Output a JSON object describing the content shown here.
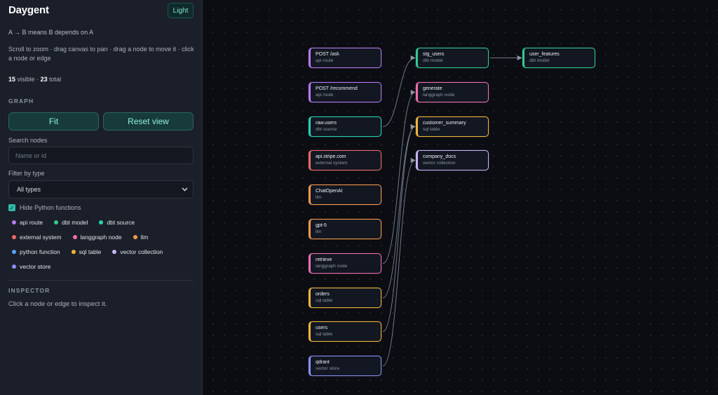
{
  "app": {
    "title": "Daygent",
    "theme_label": "Light"
  },
  "sidebar": {
    "legend_note": "A → B means B depends on A",
    "help": "Scroll to zoom · drag canvas to pan · drag a node to move it · click a node or edge",
    "visible_count": "15",
    "visible_label": "visible ·",
    "total_count": "23",
    "total_label": "total",
    "graph_header": "GRAPH",
    "fit_label": "Fit",
    "reset_label": "Reset view",
    "search_label": "Search nodes",
    "search_placeholder": "Name or id",
    "filter_label": "Filter by type",
    "filter_value": "All types",
    "hide_python_label": "Hide Python functions",
    "type_chips": [
      {
        "label": "api route",
        "color": "#b57af0"
      },
      {
        "label": "dbt model",
        "color": "#35c98f"
      },
      {
        "label": "dbt source",
        "color": "#2ad1b5"
      },
      {
        "label": "external system",
        "color": "#f06a6a"
      },
      {
        "label": "langgraph node",
        "color": "#ef6fae"
      },
      {
        "label": "llm",
        "color": "#f59a4a"
      },
      {
        "label": "python function",
        "color": "#5aa2f5"
      },
      {
        "label": "sql table",
        "color": "#f0b53a"
      },
      {
        "label": "vector collection",
        "color": "#c7b4f5"
      },
      {
        "label": "vector store",
        "color": "#8a8ff5"
      }
    ],
    "inspector_header": "INSPECTOR",
    "inspector_note": "Click a node or edge to inspect it."
  },
  "nodes": [
    {
      "id": "post-ask",
      "title": "POST /ask",
      "type": "api route",
      "color": "#b57af0"
    },
    {
      "id": "post-recommend",
      "title": "POST /recommend",
      "type": "api route",
      "color": "#b57af0"
    },
    {
      "id": "raw-users",
      "title": "raw.users",
      "type": "dbt source",
      "color": "#2ad1b5"
    },
    {
      "id": "api-stripe",
      "title": "api.stripe.com",
      "type": "external system",
      "color": "#f06a6a"
    },
    {
      "id": "chatopenai",
      "title": "ChatOpenAI",
      "type": "llm",
      "color": "#f59a4a"
    },
    {
      "id": "gpt-5",
      "title": "gpt-5",
      "type": "llm",
      "color": "#f59a4a"
    },
    {
      "id": "retrieve",
      "title": "retrieve",
      "type": "langgraph node",
      "color": "#ef6fae"
    },
    {
      "id": "orders",
      "title": "orders",
      "type": "sql table",
      "color": "#f0b53a"
    },
    {
      "id": "users",
      "title": "users",
      "type": "sql table",
      "color": "#f0b53a"
    },
    {
      "id": "qdrant",
      "title": "qdrant",
      "type": "vector store",
      "color": "#8a8ff5"
    },
    {
      "id": "stg-users",
      "title": "stg_users",
      "type": "dbt model",
      "color": "#35c98f"
    },
    {
      "id": "generate",
      "title": "generate",
      "type": "langgraph node",
      "color": "#ef6fae"
    },
    {
      "id": "customer-summary",
      "title": "customer_summary",
      "type": "sql table",
      "color": "#f0b53a"
    },
    {
      "id": "company-docs",
      "title": "company_docs",
      "type": "vector collection",
      "color": "#c7b4f5"
    },
    {
      "id": "user-features",
      "title": "user_features",
      "type": "dbt model",
      "color": "#35c98f"
    }
  ]
}
